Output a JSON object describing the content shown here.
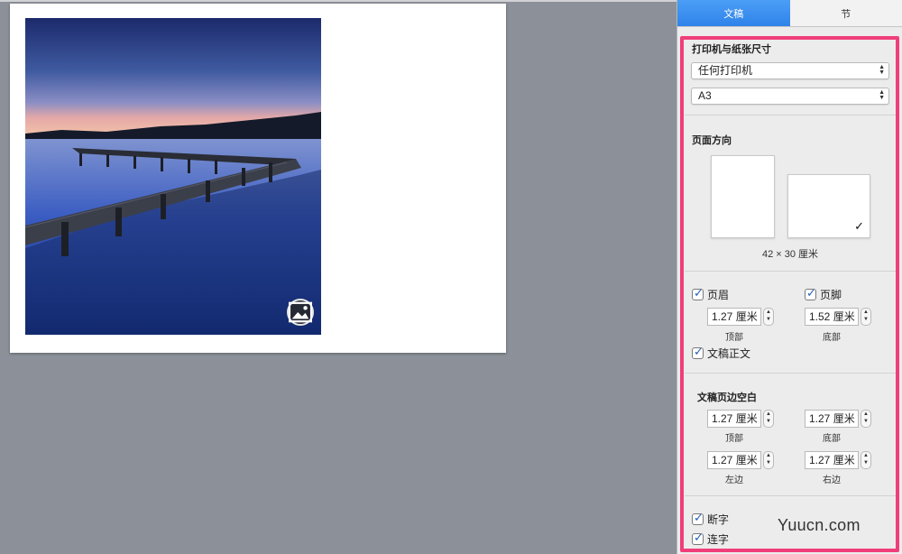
{
  "tabs": [
    {
      "label": "文稿",
      "active": true
    },
    {
      "label": "节",
      "active": false
    }
  ],
  "printer": {
    "title": "打印机与纸张尺寸",
    "printer_value": "任何打印机",
    "paper_value": "A3"
  },
  "orientation": {
    "title": "页面方向",
    "size_label": "42 × 30 厘米",
    "selected": "landscape",
    "check_mark": "✓"
  },
  "header_footer": {
    "header_label": "页眉",
    "footer_label": "页脚",
    "header_value": "1.27 厘米",
    "footer_value": "1.52 厘米",
    "header_caption": "顶部",
    "footer_caption": "底部",
    "body_label": "文稿正文"
  },
  "margins": {
    "title": "文稿页边空白",
    "top_value": "1.27 厘米",
    "bottom_value": "1.27 厘米",
    "left_value": "1.27 厘米",
    "right_value": "1.27 厘米",
    "top_caption": "顶部",
    "bottom_caption": "底部",
    "left_caption": "左边",
    "right_caption": "右边"
  },
  "options": {
    "first_label": "断字",
    "hyphen_label": "连字"
  },
  "stepper_arrows": {
    "up": "▲",
    "down": "▼"
  },
  "watermark": "Yuucn.com",
  "colors": {
    "accent_tab": "#2f83ea",
    "highlight_border": "#f03e7a",
    "canvas_bg": "#8c9199"
  },
  "icons": {
    "media": "image-icon",
    "check": "checkmark-icon"
  }
}
